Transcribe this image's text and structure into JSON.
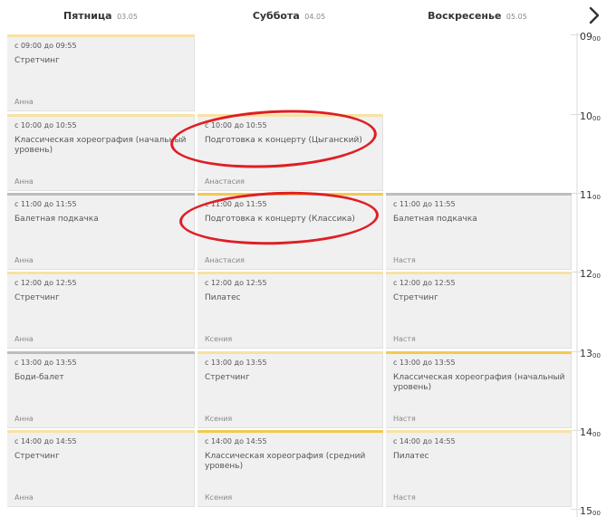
{
  "header": {
    "days": [
      {
        "name": "Пятница",
        "date": "03.05"
      },
      {
        "name": "Суббота",
        "date": "04.05"
      },
      {
        "name": "Воскресенье",
        "date": "05.05"
      }
    ],
    "next_icon": "chevron-right-icon"
  },
  "times": [
    {
      "h": "09",
      "m": "00"
    },
    {
      "h": "10",
      "m": "00"
    },
    {
      "h": "11",
      "m": "00"
    },
    {
      "h": "12",
      "m": "00"
    },
    {
      "h": "13",
      "m": "00"
    },
    {
      "h": "14",
      "m": "00"
    },
    {
      "h": "15",
      "m": "00"
    }
  ],
  "schedule": {
    "friday": [
      {
        "time": "с 09:00 до 09:55",
        "name": "Стретчинг",
        "coach": "Анна"
      },
      {
        "time": "с 10:00 до 10:55",
        "name": "Классическая хореография (начальный уровень)",
        "coach": "Анна"
      },
      {
        "time": "с 11:00 до 11:55",
        "name": "Балетная подкачка",
        "coach": "Анна"
      },
      {
        "time": "с 12:00 до 12:55",
        "name": "Стретчинг",
        "coach": "Анна"
      },
      {
        "time": "с 13:00 до 13:55",
        "name": "Боди-балет",
        "coach": "Анна"
      },
      {
        "time": "с 14:00 до 14:55",
        "name": "Стретчинг",
        "coach": "Анна"
      }
    ],
    "saturday": [
      {
        "time": "с 10:00 до 10:55",
        "name": "Подготовка к концерту (Цыганский)",
        "coach": "Анастасия"
      },
      {
        "time": "с 11:00 до 11:55",
        "name": "Подготовка к концерту (Классика)",
        "coach": "Анастасия"
      },
      {
        "time": "с 12:00 до 12:55",
        "name": "Пилатес",
        "coach": "Ксения"
      },
      {
        "time": "с 13:00 до 13:55",
        "name": "Стретчинг",
        "coach": "Ксения"
      },
      {
        "time": "с 14:00 до 14:55",
        "name": "Классическая хореография (средний уровень)",
        "coach": "Ксения"
      }
    ],
    "sunday": [
      {
        "time": "с 11:00 до 11:55",
        "name": "Балетная подкачка",
        "coach": "Настя"
      },
      {
        "time": "с 12:00 до 12:55",
        "name": "Стретчинг",
        "coach": "Настя"
      },
      {
        "time": "с 13:00 до 13:55",
        "name": "Классическая хореография (начальный уровень)",
        "coach": "Настя"
      },
      {
        "time": "с 14:00 до 14:55",
        "name": "Пилатес",
        "coach": "Настя"
      }
    ]
  },
  "colors": {
    "annotation": "#e01e24",
    "bar_yellow": "#f7e2a4",
    "bar_gold": "#f3c94e",
    "bar_gray": "#bdbdbd"
  }
}
